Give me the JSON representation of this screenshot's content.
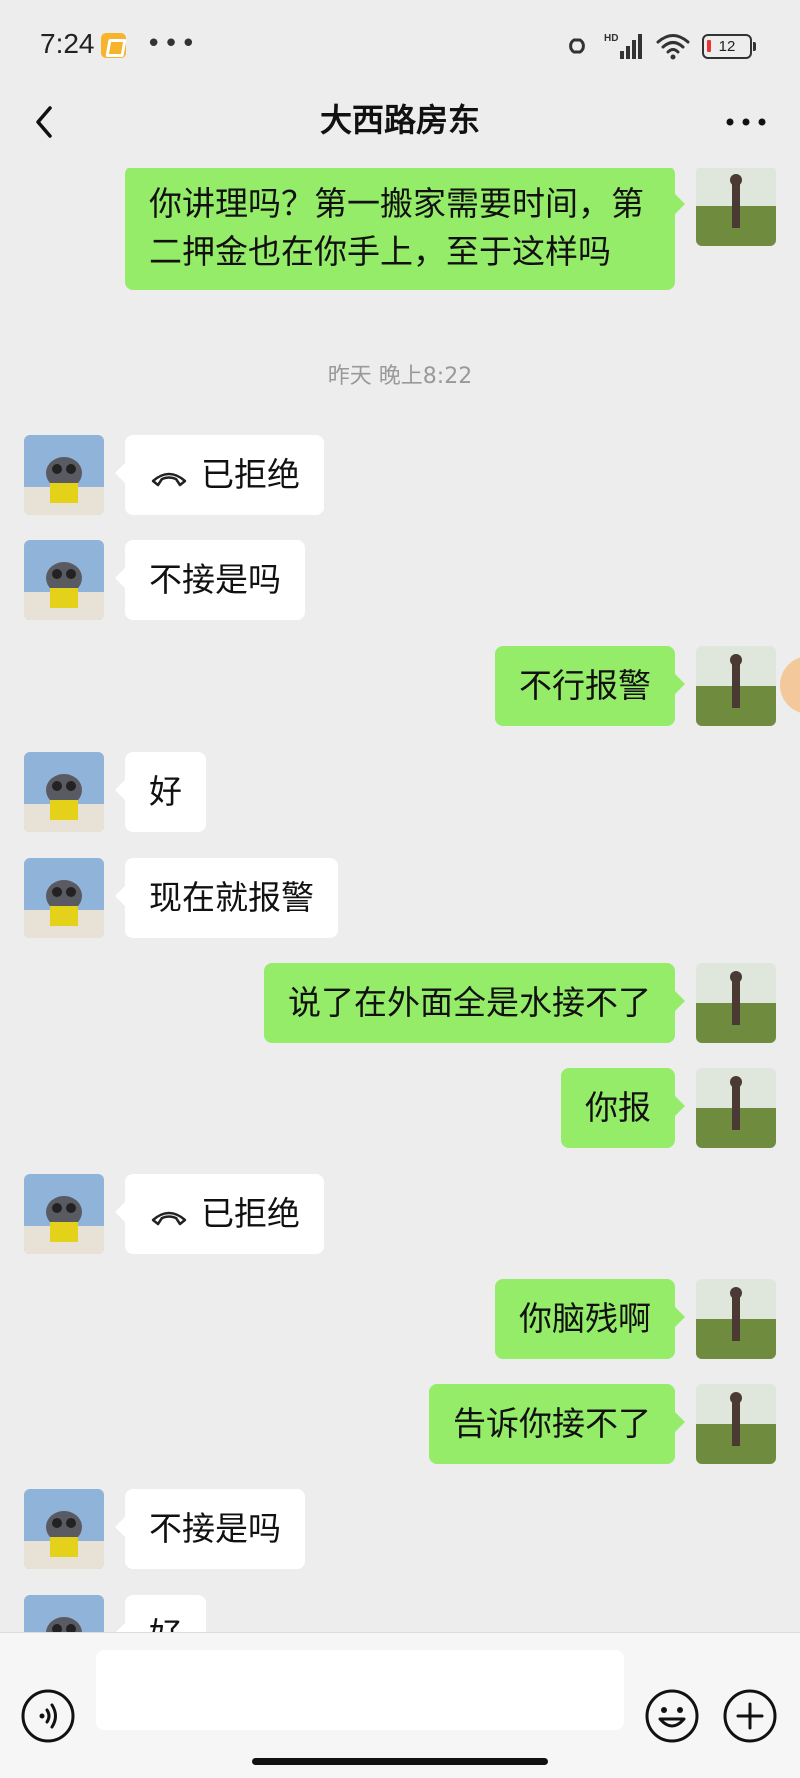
{
  "status_bar": {
    "time": "7:24",
    "battery": "12",
    "network": "HD"
  },
  "header": {
    "title": "大西路房东"
  },
  "messages": [
    {
      "side": "right",
      "text": "你讲理吗？第一搬家需要时间，第二押金也在你手上，至于这样吗"
    },
    {
      "type": "timestamp",
      "text": "昨天 晚上8:22"
    },
    {
      "side": "left",
      "type": "call",
      "text": "已拒绝"
    },
    {
      "side": "left",
      "text": "不接是吗"
    },
    {
      "side": "right",
      "text": "不行报警"
    },
    {
      "side": "left",
      "text": "好"
    },
    {
      "side": "left",
      "text": "现在就报警"
    },
    {
      "side": "right",
      "text": "说了在外面全是水接不了"
    },
    {
      "side": "right",
      "text": "你报"
    },
    {
      "side": "left",
      "type": "call",
      "text": "已拒绝"
    },
    {
      "side": "right",
      "text": "你脑残啊"
    },
    {
      "side": "right",
      "text": "告诉你接不了"
    },
    {
      "side": "left",
      "text": "不接是吗"
    },
    {
      "side": "left",
      "text": "好"
    }
  ],
  "input_bar": {
    "placeholder": ""
  },
  "colors": {
    "background": "#ededed",
    "self_bubble": "#95ec69",
    "other_bubble": "#ffffff",
    "timestamp_text": "#999999"
  },
  "icons": {
    "back": "chevron-left-icon",
    "more": "more-horizontal-icon",
    "call_declined": "phone-hangup-icon",
    "voice": "voice-icon",
    "emoji": "emoji-icon",
    "plus": "plus-circle-icon"
  }
}
